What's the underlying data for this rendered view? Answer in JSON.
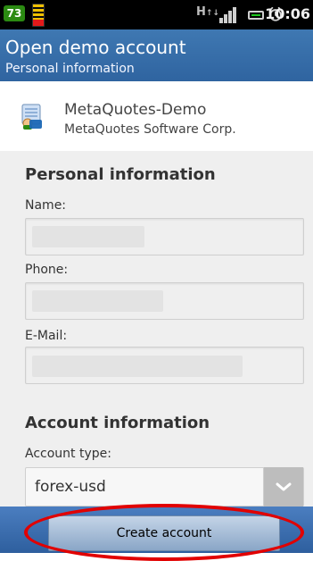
{
  "statusbar": {
    "notification_count": "73",
    "network": "H",
    "time": "10:06"
  },
  "header": {
    "title": "Open demo account",
    "subtitle": "Personal information"
  },
  "server": {
    "name": "MetaQuotes-Demo",
    "company": "MetaQuotes Software Corp."
  },
  "form": {
    "personal_section_title": "Personal information",
    "name_label": "Name:",
    "phone_label": "Phone:",
    "email_label": "E-Mail:",
    "account_section_title": "Account information",
    "account_type_label": "Account type:",
    "account_type_value": "forex-usd",
    "name_value": "",
    "phone_value": "",
    "email_value": ""
  },
  "actions": {
    "create_account_label": "Create account"
  },
  "colors": {
    "titlebar": "#3f78b2",
    "bottombar": "#2e5f9e",
    "highlight_ring": "#e10000"
  },
  "icons": {
    "server": "server-icon"
  }
}
